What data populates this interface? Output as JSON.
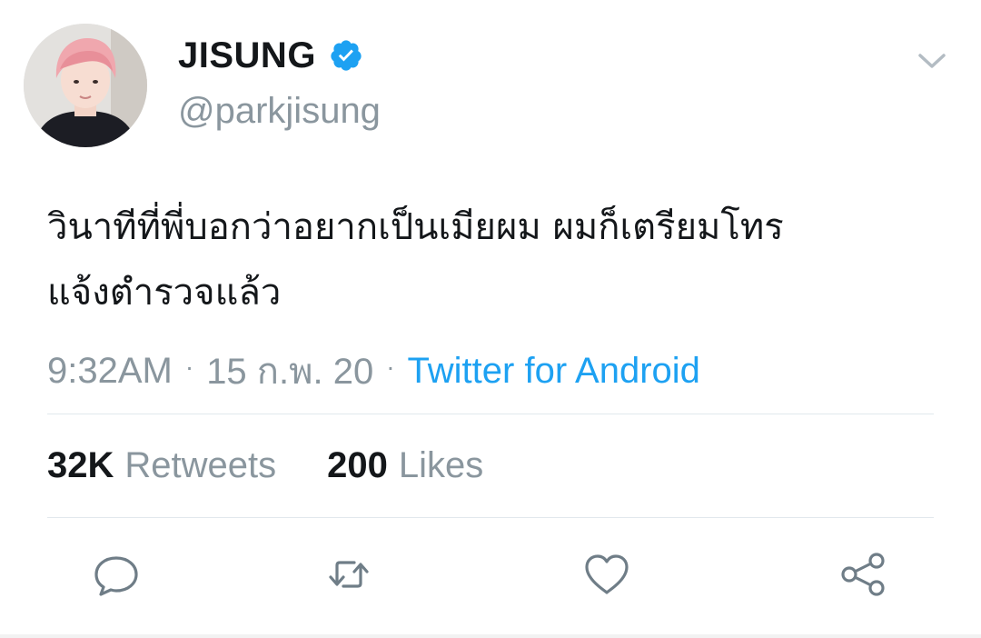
{
  "tweet": {
    "display_name": "JISUNG",
    "handle": "@parkjisung",
    "text_line1": "วินาทีที่พี่บอกว่าอยากเป็นเมียผม ผมก็เตรียมโทร",
    "text_line2": "แจ้งตำรวจแล้ว",
    "time": "9:32AM",
    "date": "15 ก.พ. 20",
    "separator": "·",
    "source": "Twitter for Android",
    "retweets_count": "32K",
    "retweets_label": "Retweets",
    "likes_count": "200",
    "likes_label": "Likes"
  },
  "icons": {
    "verified": "verified-badge-icon",
    "menu": "chevron-down-icon",
    "reply": "reply-icon",
    "retweet": "retweet-icon",
    "like": "heart-icon",
    "share": "share-icon"
  },
  "colors": {
    "link": "#1da1f2",
    "muted": "#8a969e",
    "text": "#14171a",
    "icon": "#6f7d87"
  }
}
